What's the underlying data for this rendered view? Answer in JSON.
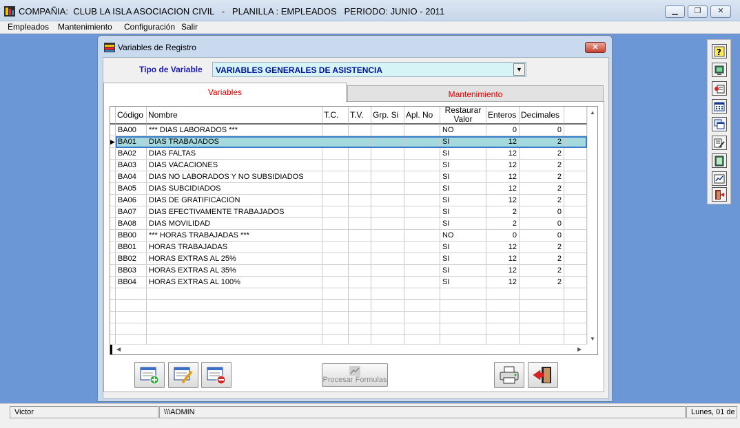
{
  "window": {
    "title": "COMPAÑIA:  CLUB LA ISLA ASOCIACION CIVIL   -   PLANILLA : EMPLEADOS   PERIODO: JUNIO - 2011"
  },
  "menu": [
    "Empleados",
    "Mantenimiento",
    "Configuración",
    "Salir"
  ],
  "dialog": {
    "title": "Variables de Registro",
    "tipo_label": "Tipo de Variable",
    "tipo_value": "VARIABLES GENERALES DE ASISTENCIA",
    "tabs": [
      "Variables",
      "Mantenimiento"
    ],
    "columns": [
      "Código",
      "Nombre",
      "T.C.",
      "T.V.",
      "Grp. Si",
      "Apl. No",
      "Restaurar Valor",
      "Enteros",
      "Decimales"
    ],
    "rows": [
      {
        "codigo": "BA00",
        "nombre": "*** DIAS LABORADOS ***",
        "restaurar": "NO",
        "enteros": "0",
        "decimales": "0"
      },
      {
        "codigo": "BA01",
        "nombre": "DIAS TRABAJADOS",
        "restaurar": "SI",
        "enteros": "12",
        "decimales": "2"
      },
      {
        "codigo": "BA02",
        "nombre": "DIAS FALTAS",
        "restaurar": "SI",
        "enteros": "12",
        "decimales": "2"
      },
      {
        "codigo": "BA03",
        "nombre": "DIAS VACACIONES",
        "restaurar": "SI",
        "enteros": "12",
        "decimales": "2"
      },
      {
        "codigo": "BA04",
        "nombre": "DIAS NO LABORADOS Y NO SUBSIDIADOS",
        "restaurar": "SI",
        "enteros": "12",
        "decimales": "2"
      },
      {
        "codigo": "BA05",
        "nombre": "DIAS SUBCIDIADOS",
        "restaurar": "SI",
        "enteros": "12",
        "decimales": "2"
      },
      {
        "codigo": "BA06",
        "nombre": "DIAS DE GRATIFICACION",
        "restaurar": "SI",
        "enteros": "12",
        "decimales": "2"
      },
      {
        "codigo": "BA07",
        "nombre": "DIAS EFECTIVAMENTE TRABAJADOS",
        "restaurar": "SI",
        "enteros": "2",
        "decimales": "0"
      },
      {
        "codigo": "BA08",
        "nombre": "DIAS MOVILIDAD",
        "restaurar": "SI",
        "enteros": "2",
        "decimales": "0"
      },
      {
        "codigo": "BB00",
        "nombre": "*** HORAS TRABAJADAS ***",
        "restaurar": "NO",
        "enteros": "0",
        "decimales": "0"
      },
      {
        "codigo": "BB01",
        "nombre": "HORAS TRABAJADAS",
        "restaurar": "SI",
        "enteros": "12",
        "decimales": "2"
      },
      {
        "codigo": "BB02",
        "nombre": "HORAS EXTRAS AL 25%",
        "restaurar": "SI",
        "enteros": "12",
        "decimales": "2"
      },
      {
        "codigo": "BB03",
        "nombre": "HORAS EXTRAS AL 35%",
        "restaurar": "SI",
        "enteros": "12",
        "decimales": "2"
      },
      {
        "codigo": "BB04",
        "nombre": "HORAS EXTRAS AL 100%",
        "restaurar": "SI",
        "enteros": "12",
        "decimales": "2"
      }
    ],
    "selected_row": 1,
    "procesar_label": "Procesar Formulas"
  },
  "status": {
    "user": "Victor",
    "path": "\\\\\\ADMIN",
    "date": "Lunes, 01 de"
  },
  "icons": {
    "toolbar": [
      "help-icon",
      "monitor-icon",
      "record-icon",
      "calendar-icon",
      "windows-icon",
      "edit-icon",
      "document-icon",
      "report-icon",
      "exit-icon"
    ],
    "bottom": [
      "add-record-icon",
      "edit-record-icon",
      "delete-record-icon",
      "chart-icon",
      "print-icon",
      "exit-door-icon"
    ]
  },
  "colors": {
    "desktop": "#6b97d6",
    "selected_row": "#a4dadd",
    "tipo_bg": "#d6f3f6",
    "tab_text": "#e00000"
  }
}
